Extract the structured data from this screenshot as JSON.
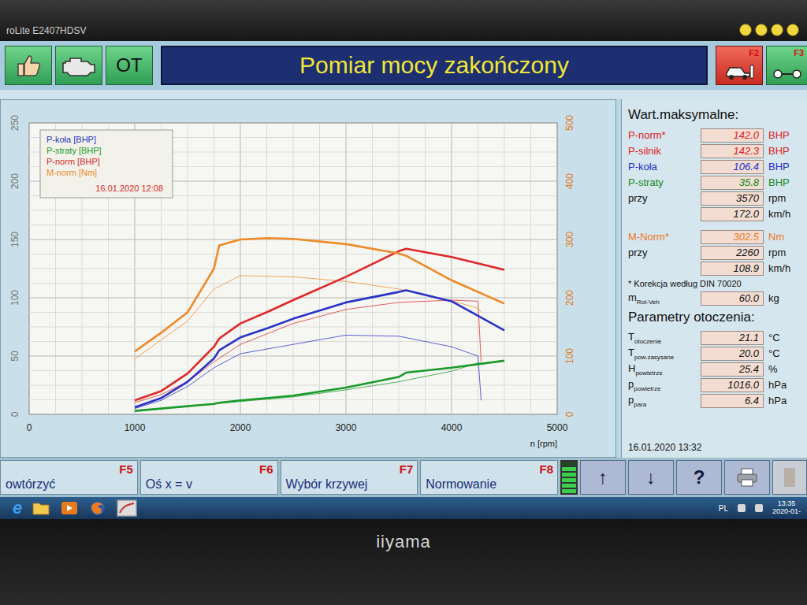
{
  "monitor": {
    "model": "roLite E2407HDSV",
    "brand": "iiyama"
  },
  "toolbar": {
    "ot_label": "OT",
    "title": "Pomiar mocy zakończony",
    "f_keys": [
      "F2",
      "F3"
    ]
  },
  "chart": {
    "legend": [
      {
        "label": "P-koła [BHP]",
        "color": "#2a32c8"
      },
      {
        "label": "P-straty [BHP]",
        "color": "#1a9a2a"
      },
      {
        "label": "P-norm [BHP]",
        "color": "#e02828"
      },
      {
        "label": "M-norm [Nm]",
        "color": "#f08a28"
      }
    ],
    "date": "16.01.2020 12:08",
    "x_ticks": [
      "0",
      "1000",
      "2000",
      "3000",
      "4000",
      "5000"
    ],
    "x_label": "n [rpm]",
    "y_left_ticks": [
      "0",
      "50",
      "100",
      "150",
      "200",
      "250"
    ],
    "y_right_ticks": [
      "0",
      "100",
      "200",
      "300",
      "400",
      "500"
    ],
    "series": [
      {
        "name": "P-norm-prev",
        "kind": "ghost",
        "axis": "left",
        "color": "#e02828",
        "rpm": [
          1000,
          1250,
          1500,
          1750,
          2000,
          2500,
          3000,
          3500,
          4000,
          4250,
          4280
        ],
        "values": [
          10,
          17,
          28,
          45,
          60,
          78,
          90,
          96,
          98,
          97,
          45
        ]
      },
      {
        "name": "P-kola-prev",
        "kind": "ghost",
        "axis": "left",
        "color": "#2a32c8",
        "rpm": [
          1000,
          1250,
          1500,
          1750,
          2000,
          2500,
          3000,
          3500,
          4000,
          4250,
          4280
        ],
        "values": [
          5,
          12,
          24,
          40,
          52,
          60,
          68,
          67,
          58,
          50,
          12
        ]
      },
      {
        "name": "P-straty-prev",
        "kind": "ghost",
        "axis": "left",
        "color": "#1a9a2a",
        "rpm": [
          1000,
          1250,
          1500,
          1750,
          2000,
          2500,
          3000,
          3500,
          4000,
          4250,
          4280
        ],
        "values": [
          3,
          5,
          7,
          9,
          11,
          15,
          21,
          28,
          37,
          44,
          44
        ]
      },
      {
        "name": "M-norm-prev",
        "kind": "ghost",
        "axis": "right",
        "color": "#f08a28",
        "rpm": [
          1000,
          1250,
          1500,
          1750,
          2000,
          2500,
          3000,
          3500,
          4000,
          4250,
          4280
        ],
        "values": [
          95,
          128,
          160,
          215,
          238,
          236,
          228,
          215,
          195,
          182,
          175
        ]
      },
      {
        "name": "P-straty",
        "kind": "main",
        "axis": "left",
        "color": "#1a9a2a",
        "rpm": [
          1000,
          1250,
          1500,
          1750,
          1800,
          2000,
          2260,
          2500,
          3000,
          3500,
          3570,
          4000,
          4500
        ],
        "values": [
          3,
          5,
          7,
          9,
          10,
          12,
          14,
          16,
          23,
          32,
          35.8,
          40,
          46
        ]
      },
      {
        "name": "P-kola",
        "kind": "main",
        "axis": "left",
        "color": "#2a32c8",
        "rpm": [
          1000,
          1250,
          1500,
          1750,
          1800,
          2000,
          2260,
          2500,
          3000,
          3500,
          3570,
          4000,
          4500
        ],
        "values": [
          6,
          14,
          28,
          48,
          55,
          66,
          74,
          82,
          96,
          105,
          106.4,
          97,
          72
        ]
      },
      {
        "name": "P-norm",
        "kind": "main",
        "axis": "left",
        "color": "#e02828",
        "rpm": [
          1000,
          1250,
          1500,
          1750,
          1800,
          2000,
          2260,
          2500,
          3000,
          3500,
          3570,
          4000,
          4500
        ],
        "values": [
          12,
          20,
          35,
          58,
          65,
          78,
          88,
          98,
          118,
          140,
          142,
          135,
          124
        ]
      },
      {
        "name": "M-norm",
        "kind": "main",
        "axis": "right",
        "color": "#f08a28",
        "rpm": [
          1000,
          1250,
          1500,
          1750,
          1800,
          2000,
          2260,
          2500,
          3000,
          3500,
          3570,
          4000,
          4500
        ],
        "values": [
          108,
          140,
          175,
          250,
          290,
          300,
          302.5,
          301,
          292,
          276,
          272,
          230,
          190
        ]
      }
    ]
  },
  "maxima": {
    "title": "Wart.maksymalne:",
    "power_rows": [
      {
        "label": "P-norm*",
        "value": "142.0",
        "unit": "BHP",
        "color": "#e02020"
      },
      {
        "label": "P-silnik",
        "value": "142.3",
        "unit": "BHP",
        "color": "#e02020"
      },
      {
        "label": "P-koła",
        "value": "106.4",
        "unit": "BHP",
        "color": "#1f2fd0"
      },
      {
        "label": "P-straty",
        "value": "35.8",
        "unit": "BHP",
        "color": "#138a20"
      },
      {
        "label": "przy",
        "value": "3570",
        "unit": "rpm",
        "color": "#111111"
      },
      {
        "label": "",
        "value": "172.0",
        "unit": "km/h",
        "color": "#111111"
      }
    ],
    "torque_rows": [
      {
        "label": "M-Norm*",
        "value": "302.5",
        "unit": "Nm",
        "color": "#f07a20"
      },
      {
        "label": "przy",
        "value": "2260",
        "unit": "rpm",
        "color": "#111111"
      },
      {
        "label": "",
        "value": "108.9",
        "unit": "km/h",
        "color": "#111111"
      }
    ],
    "note": "* Korekcja według DIN 70020",
    "mass": {
      "label": "m",
      "sub": "Rot-Veh",
      "value": "60.0",
      "unit": "kg"
    }
  },
  "environment": {
    "title": "Parametry otoczenia:",
    "rows": [
      {
        "label": "T",
        "sub": "otoczenie",
        "value": "21.1",
        "unit": "°C"
      },
      {
        "label": "T",
        "sub": "pow.zasysane",
        "value": "20.0",
        "unit": "°C"
      },
      {
        "label": "H",
        "sub": "powietrze",
        "value": "25.4",
        "unit": "%"
      },
      {
        "label": "p",
        "sub": "powietrze",
        "value": "1016.0",
        "unit": "hPa"
      },
      {
        "label": "p",
        "sub": "para",
        "value": "6.4",
        "unit": "hPa"
      }
    ],
    "date": "16.01.2020 13:32"
  },
  "function_keys": [
    {
      "label": "owtórzyć",
      "key": "F5"
    },
    {
      "label": "Oś x = v",
      "key": "F6"
    },
    {
      "label": "Wybór krzywej",
      "key": "F7"
    },
    {
      "label": "Normowanie",
      "key": "F8"
    }
  ],
  "meter": {
    "level": 0.8
  },
  "nav_buttons": [
    {
      "kind": "glyph",
      "glyph": "↑",
      "disabled": false
    },
    {
      "kind": "glyph",
      "glyph": "↓",
      "disabled": false
    },
    {
      "kind": "glyph",
      "glyph": "?",
      "disabled": false
    },
    {
      "kind": "printer",
      "glyph": "",
      "disabled": false
    },
    {
      "kind": "blank",
      "glyph": "",
      "disabled": true
    }
  ],
  "taskbar": {
    "ie_glyph": "e",
    "lang": "PL",
    "time": "13:35",
    "date": "2020-01-"
  }
}
